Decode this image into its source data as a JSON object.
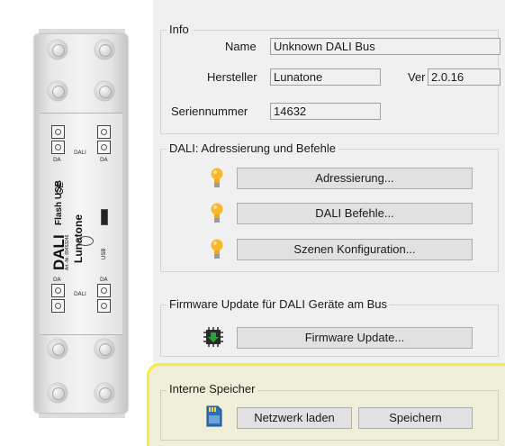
{
  "device": {
    "brand": "DALI",
    "product": "Flash USB",
    "manufacturer": "Lunatone",
    "article_no": "Art.-Nr. 89453246",
    "ce_mark": "CE",
    "port_label": "USB",
    "terminal_bus_label": "DALI",
    "terminal_label": "DA"
  },
  "info": {
    "title": "Info",
    "name_label": "Name",
    "name_value": "Unknown DALI Bus",
    "manufacturer_label": "Hersteller",
    "manufacturer_value": "Lunatone",
    "version_label": "Ver",
    "version_value": "2.0.16",
    "serial_label": "Seriennummer",
    "serial_value": "14632"
  },
  "dali": {
    "title": "DALI: Adressierung und Befehle",
    "addressing_button": "Adressierung...",
    "commands_button": "DALI Befehle...",
    "scenes_button": "Szenen Konfiguration..."
  },
  "firmware": {
    "title": "Firmware Update für DALI Geräte am Bus",
    "update_button": "Firmware Update..."
  },
  "memory": {
    "title": "Interne Speicher",
    "load_button": "Netzwerk laden",
    "save_button": "Speichern"
  },
  "colors": {
    "highlight_border": "#f0ee3a",
    "bulb": "#f7b72e",
    "chip_arrow": "#2f9e3f",
    "sd_card": "#2a6fb8"
  }
}
